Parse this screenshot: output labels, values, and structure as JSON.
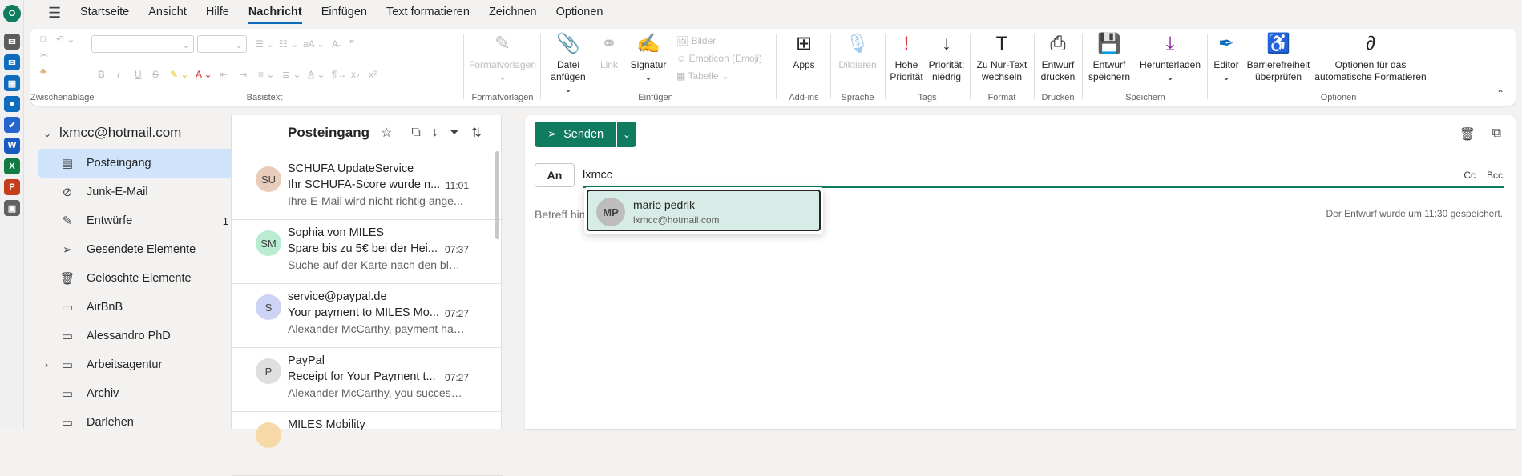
{
  "app_rail": [
    {
      "icon": "outlook-logo-icon",
      "color": "#0f7b5f",
      "glyph": "O"
    },
    {
      "icon": "mail-send-icon",
      "color": "#5c5c5c",
      "glyph": "✉"
    },
    {
      "icon": "mail-icon",
      "color": "#0f6cbd",
      "glyph": "✉"
    },
    {
      "icon": "calendar-icon",
      "color": "#0f6cbd",
      "glyph": "▦"
    },
    {
      "icon": "people-icon",
      "color": "#0f6cbd",
      "glyph": "●"
    },
    {
      "icon": "todo-icon",
      "color": "#2564cf",
      "glyph": "✔"
    },
    {
      "icon": "word-icon",
      "color": "#185abd",
      "glyph": "W"
    },
    {
      "icon": "excel-icon",
      "color": "#107c41",
      "glyph": "X"
    },
    {
      "icon": "powerpoint-icon",
      "color": "#c43e1c",
      "glyph": "P"
    },
    {
      "icon": "apps-icon",
      "color": "#616161",
      "glyph": "▣"
    }
  ],
  "tabs": [
    "Startseite",
    "Ansicht",
    "Hilfe",
    "Nachricht",
    "Einfügen",
    "Text formatieren",
    "Zeichnen",
    "Optionen"
  ],
  "active_tab": "Nachricht",
  "ribbon": {
    "groups": {
      "clipboard": "Zwischenablage",
      "basic": "Basistext",
      "styles": "Formatvorlagen",
      "insert": "Einfügen",
      "addins": "Add-ins",
      "speech": "Sprache",
      "tags": "Tags",
      "format": "Format",
      "print": "Drucken",
      "save": "Speichern",
      "options": "Optionen"
    },
    "buttons": {
      "formatvorlagen": "Formatvorlagen",
      "attach": "Datei anfügen",
      "link": "Link",
      "signature": "Signatur",
      "images": "Bilder",
      "emoticon": "Emoticon (Emoji)",
      "table": "Tabelle",
      "apps": "Apps",
      "dictate": "Diktieren",
      "high": "Hohe Priorität",
      "low": "Priorität: niedrig",
      "plaintext": "Zu Nur-Text wechseln",
      "print": "Entwurf drucken",
      "savedraft": "Entwurf speichern",
      "download": "Herunterladen",
      "editor": "Editor",
      "access": "Barrierefreiheit überprüfen",
      "autoformat": "Optionen für das automatische Formatieren"
    }
  },
  "sidebar": {
    "account": "lxmcc@hotmail.com",
    "folders": [
      {
        "label": "Posteingang",
        "icon": "inbox-icon",
        "glyph": "▤",
        "count": ""
      },
      {
        "label": "Junk-E-Mail",
        "icon": "junk-icon",
        "glyph": "⊘",
        "count": ""
      },
      {
        "label": "Entwürfe",
        "icon": "drafts-icon",
        "glyph": "✎",
        "count": "1"
      },
      {
        "label": "Gesendete Elemente",
        "icon": "sent-icon",
        "glyph": "➢",
        "count": ""
      },
      {
        "label": "Gelöschte Elemente",
        "icon": "trash-icon",
        "glyph": "🗑",
        "count": ""
      },
      {
        "label": "AirBnB",
        "icon": "folder-icon",
        "glyph": "▭",
        "count": ""
      },
      {
        "label": "Alessandro PhD",
        "icon": "folder-icon",
        "glyph": "▭",
        "count": ""
      },
      {
        "label": "Arbeitsagentur",
        "icon": "folder-icon",
        "glyph": "▭",
        "count": ""
      },
      {
        "label": "Archiv",
        "icon": "archive-icon",
        "glyph": "▭",
        "count": ""
      },
      {
        "label": "Darlehen",
        "icon": "folder-icon",
        "glyph": "▭",
        "count": ""
      }
    ]
  },
  "list": {
    "title": "Posteingang",
    "messages": [
      {
        "initials": "SU",
        "color": "#e8cbb8",
        "sender": "SCHUFA UpdateService",
        "subject": "Ihr SCHUFA-Score wurde n...",
        "time": "11:01",
        "preview": "Ihre E-Mail wird nicht richtig ange..."
      },
      {
        "initials": "SM",
        "color": "#b9ecd0",
        "sender": "Sophia von MILES",
        "subject": "Spare bis zu 5€ bei der Hei...",
        "time": "07:37",
        "preview": "Suche auf der Karte nach den blau..."
      },
      {
        "initials": "S",
        "color": "#cdd3f4",
        "sender": "service@paypal.de",
        "subject": "Your payment to MILES Mo...",
        "time": "07:27",
        "preview": "Alexander McCarthy, payment has..."
      },
      {
        "initials": "P",
        "color": "#e1dfdd",
        "sender": "PayPal",
        "subject": "Receipt for Your Payment t...",
        "time": "07:27",
        "preview": "Alexander McCarthy, you successf..."
      },
      {
        "initials": "",
        "color": "#f7d9a8",
        "sender": "MILES Mobility",
        "subject": "",
        "time": "",
        "preview": ""
      }
    ]
  },
  "compose": {
    "send": "Senden",
    "to_label": "An",
    "to_value": "lxmcc",
    "cc": "Cc",
    "bcc": "Bcc",
    "subject_placeholder": "Betreff hin",
    "saved_status": "Der Entwurf wurde um 11:30 gespeichert.",
    "suggestion": {
      "initials": "MP",
      "name": "mario pedrik",
      "email": "lxmcc@hotmail.com"
    }
  }
}
